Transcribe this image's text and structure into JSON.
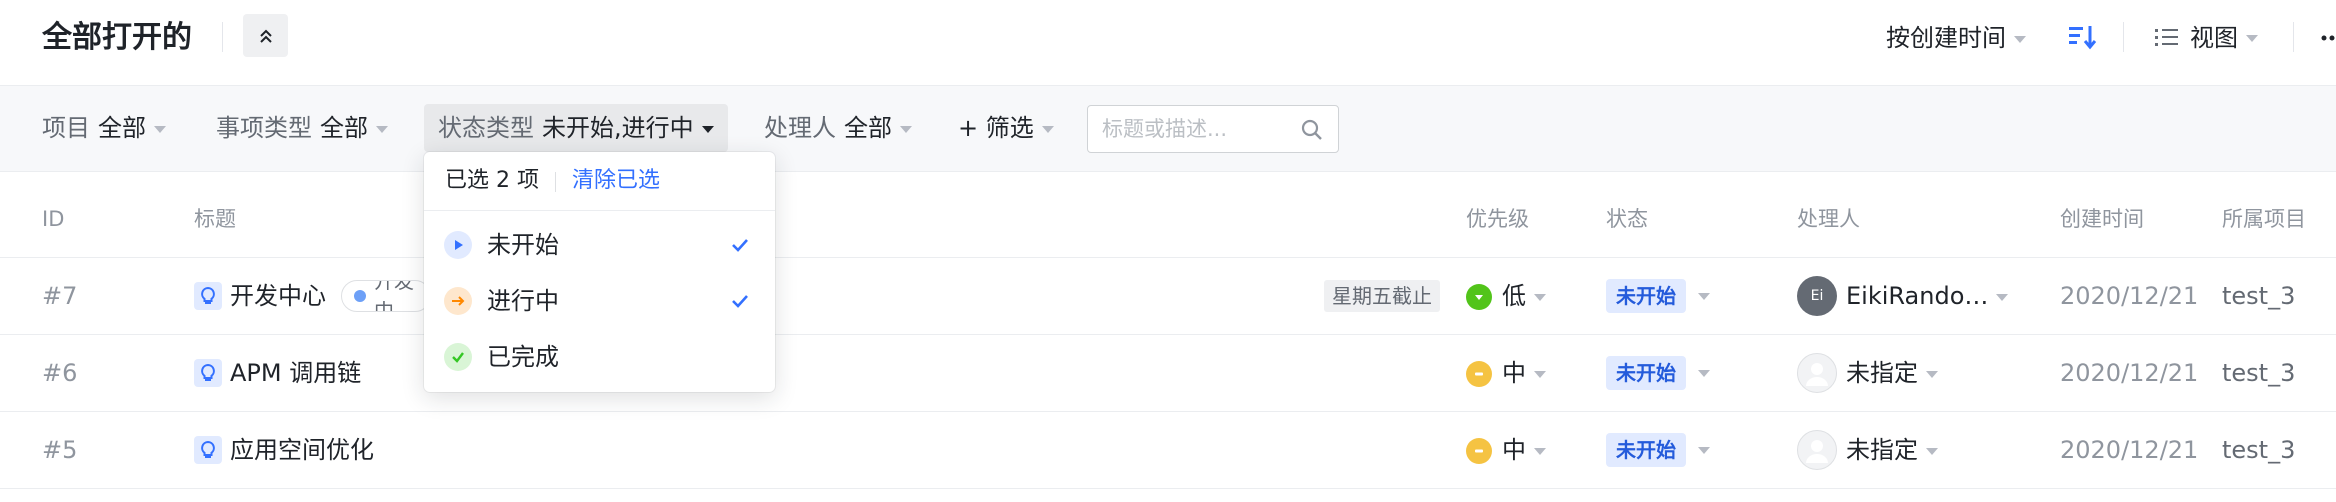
{
  "header": {
    "title": "全部打开的",
    "sort_label": "按创建时间",
    "view_label": "视图"
  },
  "filters": {
    "project": {
      "label": "项目",
      "value": "全部"
    },
    "issue_type": {
      "label": "事项类型",
      "value": "全部"
    },
    "status_type": {
      "label": "状态类型",
      "value": "未开始,进行中"
    },
    "assignee": {
      "label": "处理人",
      "value": "全部"
    },
    "add_filter": "+ 筛选",
    "search_placeholder": "标题或描述..."
  },
  "columns": [
    "ID",
    "标题",
    "优先级",
    "状态",
    "处理人",
    "创建时间",
    "所属项目"
  ],
  "rows": [
    {
      "id": "#7",
      "title": "开发中心",
      "tag": "开发中",
      "deadline": "星期五截止",
      "priority": "低",
      "priority_color": "#52c41a",
      "status": "未开始",
      "assignee": "EikiRando…",
      "avatar_initials": "Ei",
      "created": "2020/12/21",
      "project": "test_3"
    },
    {
      "id": "#6",
      "title": "APM 调用链",
      "priority": "中",
      "priority_color": "#f5c342",
      "status": "未开始",
      "assignee": "未指定",
      "created": "2020/12/21",
      "project": "test_3"
    },
    {
      "id": "#5",
      "title": "应用空间优化",
      "priority": "中",
      "priority_color": "#f5c342",
      "status": "未开始",
      "assignee": "未指定",
      "created": "2020/12/21",
      "project": "test_3"
    }
  ],
  "dropdown": {
    "selected_count": "已选 2 项",
    "clear_label": "清除已选",
    "options": [
      {
        "label": "未开始",
        "checked": true,
        "icon": "play-icon",
        "color": "#3370ff"
      },
      {
        "label": "进行中",
        "checked": true,
        "icon": "arrow-right-icon",
        "color": "#ff8800"
      },
      {
        "label": "已完成",
        "checked": false,
        "icon": "check-icon",
        "color": "#34c724"
      }
    ]
  },
  "colors": {
    "accent": "#3370ff",
    "status_bg": "#e1eaff",
    "status_text": "#245bdb"
  }
}
